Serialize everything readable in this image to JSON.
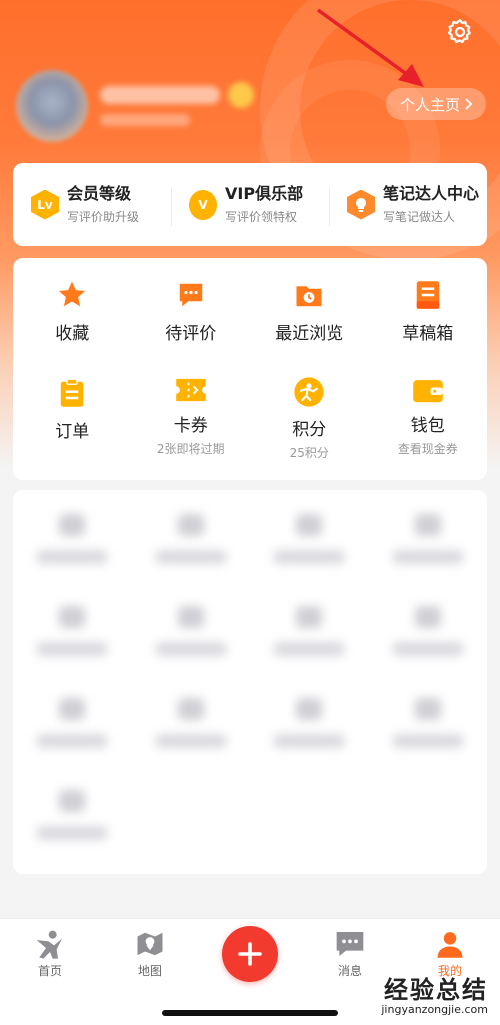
{
  "header": {
    "homepage_label": "个人主页"
  },
  "member_bar": [
    {
      "icon": "lv-badge-icon",
      "badge": "Lv",
      "title": "会员等级",
      "subtitle": "写评价助升级"
    },
    {
      "icon": "vip-badge-icon",
      "badge": "V",
      "title": "VIP俱乐部",
      "subtitle": "写评价领特权"
    },
    {
      "icon": "lightbulb-badge-icon",
      "badge": "",
      "title": "笔记达人中心",
      "subtitle": "写笔记做达人"
    }
  ],
  "functions": [
    {
      "icon": "star-icon",
      "label": "收藏",
      "sub": ""
    },
    {
      "icon": "comment-icon",
      "label": "待评价",
      "sub": ""
    },
    {
      "icon": "history-icon",
      "label": "最近浏览",
      "sub": ""
    },
    {
      "icon": "draft-icon",
      "label": "草稿箱",
      "sub": ""
    },
    {
      "icon": "order-icon",
      "label": "订单",
      "sub": ""
    },
    {
      "icon": "coupon-icon",
      "label": "卡券",
      "sub": "2张即将过期"
    },
    {
      "icon": "points-icon",
      "label": "积分",
      "sub": "25积分"
    },
    {
      "icon": "wallet-icon",
      "label": "钱包",
      "sub": "查看现金券"
    }
  ],
  "tabbar": {
    "home": "首页",
    "map": "地图",
    "messages": "消息",
    "mine": "我的"
  },
  "watermark": {
    "big": "经验总结",
    "small": "jingyanzongjie.com"
  },
  "colors": {
    "accent": "#ff6a1f",
    "plus": "#f23a2f",
    "icon_orange": "#ff7a1a",
    "icon_yellow": "#ffb300"
  }
}
